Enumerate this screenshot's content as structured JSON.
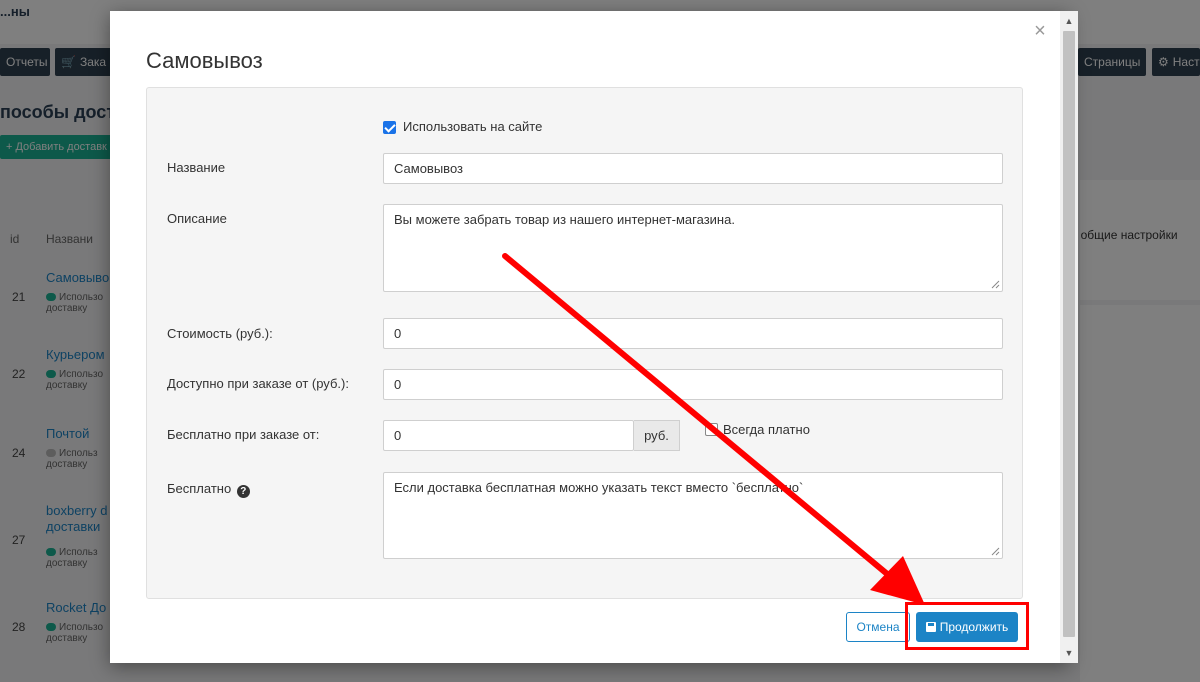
{
  "background": {
    "logo": "...ны",
    "nav": {
      "reports": "Отчеты",
      "orders": "Зака",
      "pages": "Страницы",
      "settings": "Наст"
    },
    "heading": "пособы доста",
    "add_button": "+ Добавить доставк",
    "table": {
      "col_id": "id",
      "col_name": "Названи",
      "rows": [
        {
          "id": "21",
          "name": "Самовыво",
          "status": "Использо доставку",
          "enabled": true
        },
        {
          "id": "22",
          "name": "Курьером",
          "status": "Использо доставку",
          "enabled": true
        },
        {
          "id": "24",
          "name": "Почтой",
          "status": "Использ доставку",
          "enabled": false
        },
        {
          "id": "27",
          "name": "boxberry d доставки",
          "status": "Использ доставку",
          "enabled": true
        },
        {
          "id": "28",
          "name": "Rocket До",
          "status": "Использо доставку",
          "enabled": true
        }
      ]
    },
    "right_text": "к общие настройки"
  },
  "modal": {
    "title": "Самовывоз",
    "close_symbol": "×",
    "use_on_site": {
      "label": "Использовать на сайте",
      "checked": true
    },
    "name": {
      "label": "Название",
      "value": "Самовывоз"
    },
    "description": {
      "label": "Описание",
      "value": "Вы можете забрать товар из нашего интернет-магазина."
    },
    "cost": {
      "label": "Стоимость (руб.):",
      "value": "0"
    },
    "available_from": {
      "label": "Доступно при заказе от (руб.):",
      "value": "0"
    },
    "free_from": {
      "label": "Бесплатно при заказе от:",
      "value": "0",
      "addon": "руб."
    },
    "always_paid": {
      "label": "Всегда платно",
      "checked": false
    },
    "free_text": {
      "label": "Бесплатно",
      "help_symbol": "?",
      "value": "Если доставка бесплатная можно указать текст вместо `бесплатно`"
    },
    "buttons": {
      "cancel": "Отмена",
      "continue": "Продолжить"
    }
  },
  "colors": {
    "primary": "#1c84c6",
    "annotation": "#ff0000",
    "checkbox": "#1a73e8"
  }
}
